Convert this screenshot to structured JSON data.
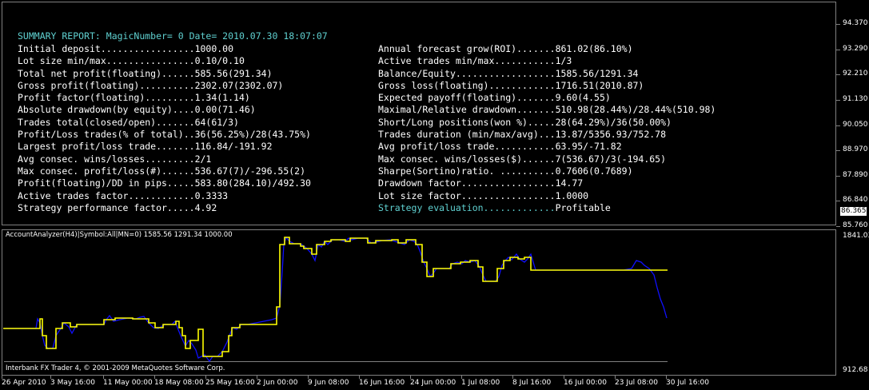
{
  "report": {
    "title": "SUMMARY REPORT: MagicNumber= 0 Date= 2010.07.30 18:07:07",
    "left": [
      {
        "label": "Initial deposit.................",
        "value": "1000.00"
      },
      {
        "label": "Lot size min/max................",
        "value": "0.10/0.10"
      },
      {
        "label": "Total net profit(floating)......",
        "value": "585.56(291.34)"
      },
      {
        "label": "Gross profit(floating)..........",
        "value": "2302.07(2302.07)"
      },
      {
        "label": "Profit factor(floating).........",
        "value": "1.34(1.14)"
      },
      {
        "label": "Absolute drawdown(by equity)....",
        "value": "0.00(71.46)"
      },
      {
        "label": "Trades total(closed/open).......",
        "value": "64(61/3)"
      },
      {
        "label": "Profit/Loss trades(% of total)..",
        "value": "36(56.25%)/28(43.75%)"
      },
      {
        "label": "Largest profit/loss trade.......",
        "value": "116.84/-191.92"
      },
      {
        "label": "Avg consec. wins/losses.........",
        "value": "2/1"
      },
      {
        "label": "Max consec. profit/loss(#)......",
        "value": "536.67(7)/-296.55(2)"
      },
      {
        "label": "Profit(floating)/DD in pips.....",
        "value": "583.80(284.10)/492.30"
      },
      {
        "label": "Active trades factor............",
        "value": "0.3333"
      },
      {
        "label": "Strategy performance factor.....",
        "value": "4.92"
      }
    ],
    "right": [
      {
        "label": "Annual forecast grow(ROI).......",
        "value": "861.02(86.10%)"
      },
      {
        "label": "Active trades min/max...........",
        "value": "1/3"
      },
      {
        "label": "Balance/Equity..................",
        "value": "1585.56/1291.34"
      },
      {
        "label": "Gross loss(floating)............",
        "value": "1716.51(2010.87)"
      },
      {
        "label": "Expected payoff(floating).......",
        "value": "9.60(4.55)"
      },
      {
        "label": "Maximal/Relative drawdown.......",
        "value": "510.98(28.44%)/28.44%(510.98)"
      },
      {
        "label": "Short/Long positions(won %).....",
        "value": "28(64.29%)/36(50.00%)"
      },
      {
        "label": "Trades duration (min/max/avg)...",
        "value": "13.87/5356.93/752.78"
      },
      {
        "label": "Avg profit/loss trade...........",
        "value": "63.95/-71.82"
      },
      {
        "label": "Max consec. wins/losses($)......",
        "value": "7(536.67)/3(-194.65)"
      },
      {
        "label": "Sharpe(Sortino)ratio. ..........",
        "value": "0.7606(0.7689)"
      },
      {
        "label": "Drawdown factor.................",
        "value": "14.77"
      },
      {
        "label": "Lot size factor.................",
        "value": "1.0000"
      },
      {
        "label": "Strategy evaluation.............",
        "value": "Profitable"
      }
    ]
  },
  "price_axis": {
    "labels": [
      "94.370",
      "93.290",
      "92.210",
      "91.130",
      "90.050",
      "88.970",
      "87.890",
      "86.840",
      "85.760"
    ],
    "current_price": "86.365"
  },
  "indicator": {
    "title": "AccountAnalyzer(H4)|Symbol:All|MN=0) 1585.56 1291.34 1000.00",
    "axis_max": "1841.03",
    "axis_min": "912.68",
    "copyright": "Interbank FX Trader 4, © 2001-2009 MetaQuotes Software Corp."
  },
  "time_axis": [
    "26 Apr 2010",
    "3 May 16:00",
    "11 May 00:00",
    "18 May 08:00",
    "25 May 16:00",
    "2 Jun 00:00",
    "9 Jun 08:00",
    "16 Jun 16:00",
    "24 Jun 00:00",
    "1 Jul 08:00",
    "8 Jul 16:00",
    "16 Jul 00:00",
    "23 Jul 08:00",
    "30 Jul 16:00"
  ],
  "colors": {
    "balance": "#ffff00",
    "equity": "#1010ff",
    "title": "#5fd0d0"
  }
}
